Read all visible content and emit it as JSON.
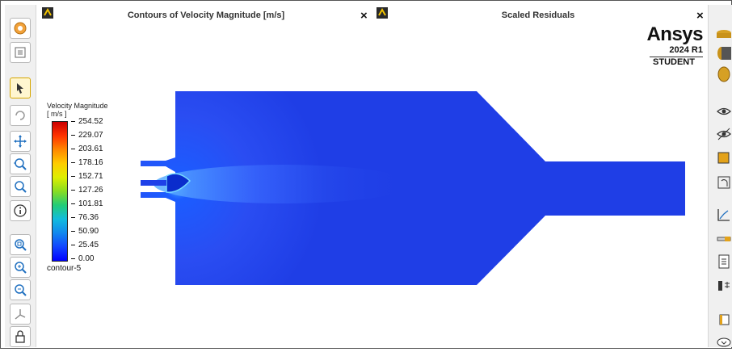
{
  "tabs": [
    {
      "title": "Contours of Velocity Magnitude [m/s]",
      "close": "×"
    },
    {
      "title": "Scaled Residuals",
      "close": "×"
    }
  ],
  "brand": {
    "logo": "Ansys",
    "version": "2024 R1",
    "edition": "STUDENT"
  },
  "legend": {
    "title": "Velocity Magnitude",
    "unit": "[ m/s ]",
    "ticks": [
      "254.52",
      "229.07",
      "203.61",
      "178.16",
      "152.71",
      "127.26",
      "101.81",
      "76.36",
      "50.90",
      "25.45",
      "0.00"
    ],
    "footer": "contour-5",
    "colors": [
      "#cc0000",
      "#ff4400",
      "#ff9900",
      "#ffd500",
      "#ccee00",
      "#66dd22",
      "#22cc88",
      "#11bbdd",
      "#1188ee",
      "#1144ff",
      "#0000ff"
    ]
  },
  "left_toolbar": [
    "settings-icon",
    "fit-window-icon",
    "select-pointer-icon",
    "rotate-icon",
    "pan-icon",
    "zoom-in-icon",
    "zoom-box-icon",
    "info-icon",
    "zoom-fit-icon",
    "zoom-in-magnifier-icon",
    "zoom-out-magnifier-icon",
    "axes-icon",
    "lock-icon"
  ],
  "right_toolbar": [
    "view-top-icon",
    "view-left-icon",
    "view-front-icon",
    "eye-icon",
    "eye-hidden-icon",
    "box-icon",
    "rotate-back-icon",
    "chart-icon",
    "slider-icon",
    "document-icon",
    "bar-icon",
    "copy-icon",
    "more-icon"
  ],
  "colors": {
    "field_blue": "#1f3ee6",
    "inlet_cyan": "#5fb3ff"
  }
}
